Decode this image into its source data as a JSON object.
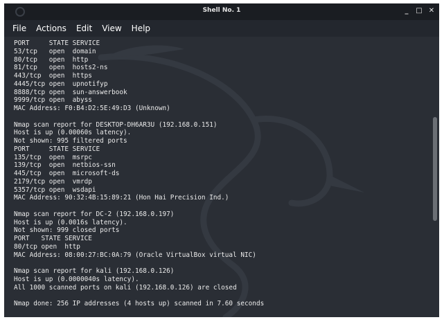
{
  "window": {
    "title": "Shell No. 1",
    "controls": [
      "_",
      "□",
      "✕"
    ]
  },
  "menu": [
    "File",
    "Actions",
    "Edit",
    "View",
    "Help"
  ],
  "terminal": {
    "lines": [
      "PORT     STATE SERVICE",
      "53/tcp   open  domain",
      "80/tcp   open  http",
      "81/tcp   open  hosts2-ns",
      "443/tcp  open  https",
      "4445/tcp open  upnotifyp",
      "8888/tcp open  sun-answerbook",
      "9999/tcp open  abyss",
      "MAC Address: F0:B4:D2:5E:49:D3 (Unknown)",
      "",
      "Nmap scan report for DESKTOP-DH6AR3U (192.168.0.151)",
      "Host is up (0.00060s latency).",
      "Not shown: 995 filtered ports",
      "PORT     STATE SERVICE",
      "135/tcp  open  msrpc",
      "139/tcp  open  netbios-ssn",
      "445/tcp  open  microsoft-ds",
      "2179/tcp open  vmrdp",
      "5357/tcp open  wsdapi",
      "MAC Address: 90:32:4B:15:89:21 (Hon Hai Precision Ind.)",
      "",
      "Nmap scan report for DC-2 (192.168.0.197)",
      "Host is up (0.0016s latency).",
      "Not shown: 999 closed ports",
      "PORT   STATE SERVICE",
      "80/tcp open  http",
      "MAC Address: 08:00:27:BC:0A:79 (Oracle VirtualBox virtual NIC)",
      "",
      "Nmap scan report for kali (192.168.0.126)",
      "Host is up (0.0000040s latency).",
      "All 1000 scanned ports on kali (192.168.0.126) are closed",
      "",
      "Nmap done: 256 IP addresses (4 hosts up) scanned in 7.60 seconds"
    ]
  }
}
